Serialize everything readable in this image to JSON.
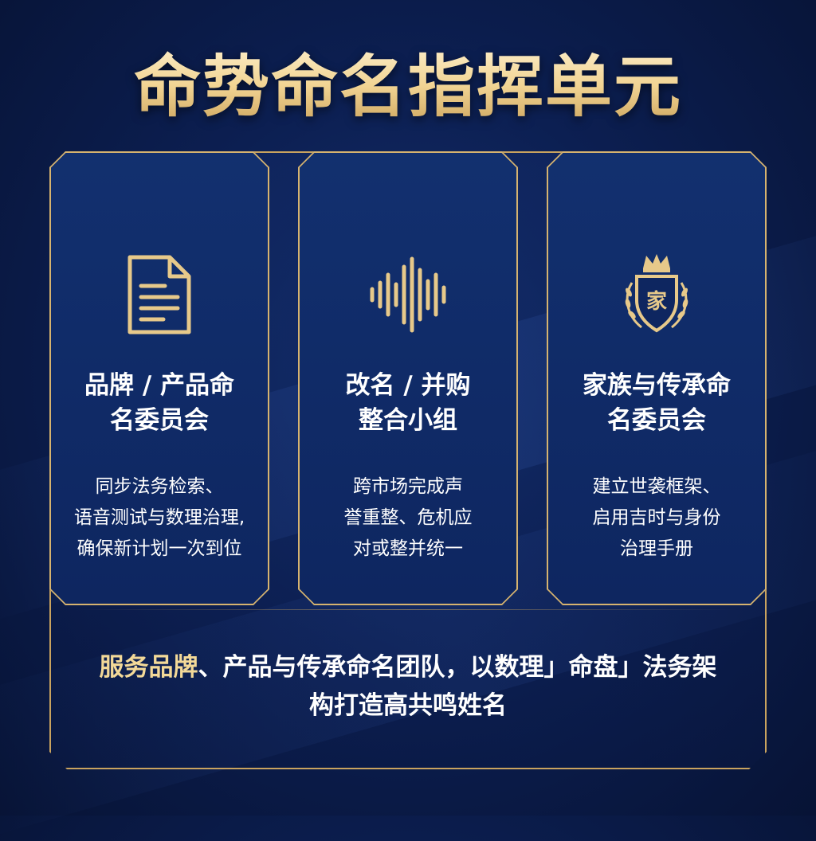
{
  "title": "命势命名指挥单元",
  "colors": {
    "gold": "#d6b36f",
    "navy": "#0c1f52",
    "highlight": "#f3d998"
  },
  "cards": [
    {
      "icon": "document-icon",
      "title": "品牌 / 产品命\n名委员会",
      "desc": "同步法务检索、\n语音测试与数理治理,\n确保新计划一次到位"
    },
    {
      "icon": "sound-wave-icon",
      "title": "改名 / 并购\n整合小组",
      "desc": "跨市场完成声\n誉重整、危机应\n对或整并统一"
    },
    {
      "icon": "family-crest-icon",
      "crest_char": "家",
      "title": "家族与传承命\n名委员会",
      "desc": "建立世袭框架、\n启用吉时与身份\n治理手册"
    }
  ],
  "footer": {
    "highlight": "服务品牌",
    "text": "、产品与传承命名团队，以数理」命盘」法务架构打造高共鸣姓名"
  }
}
